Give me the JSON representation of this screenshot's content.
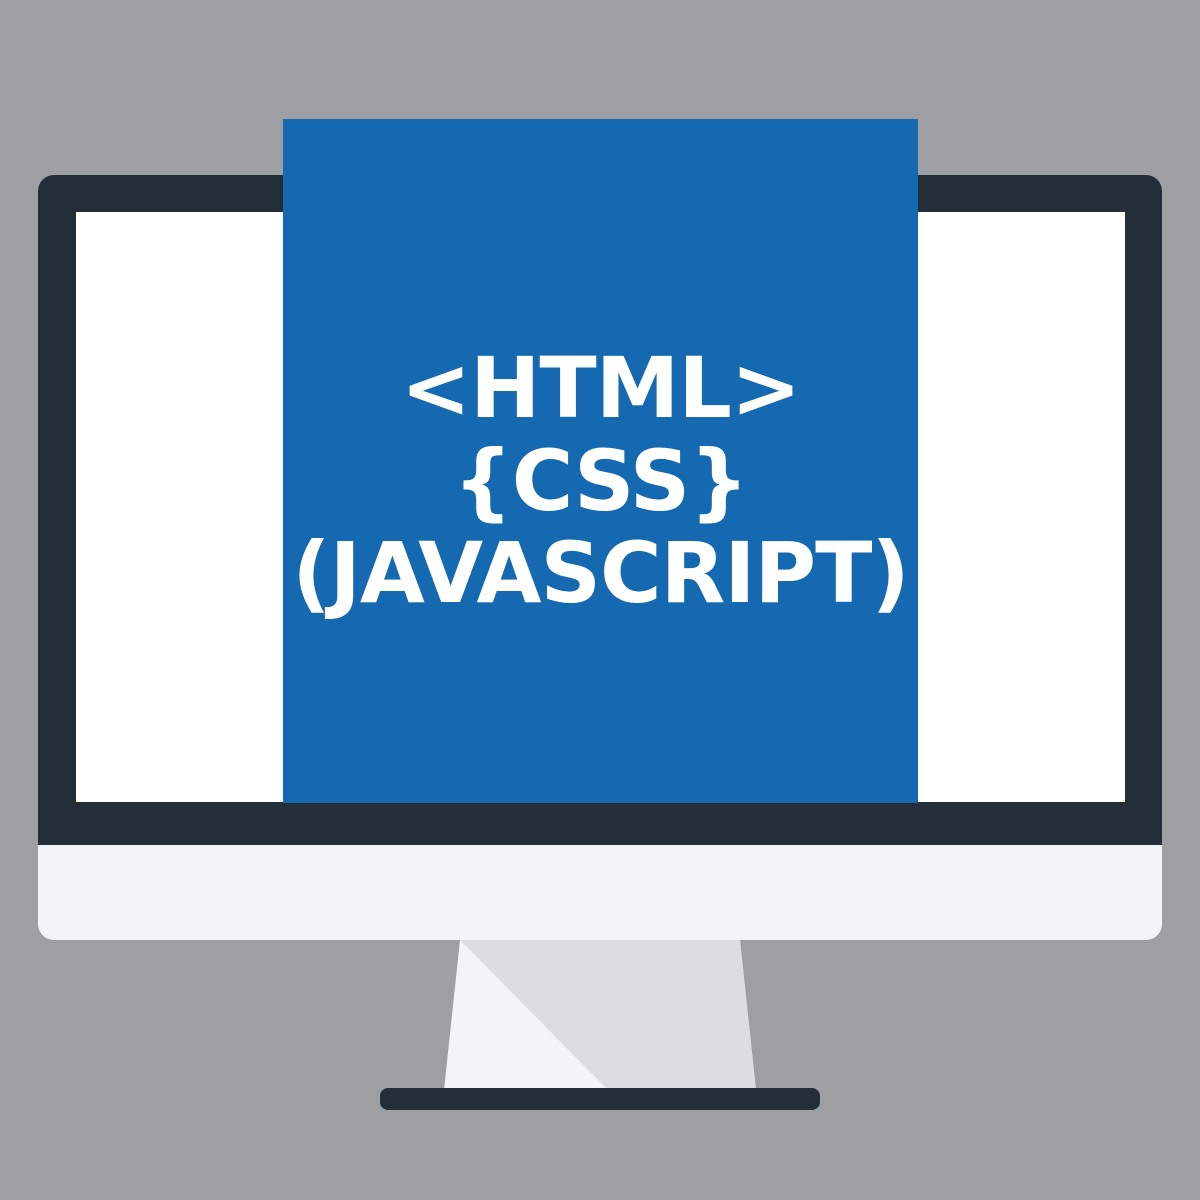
{
  "illustration": {
    "subject": "desktop-monitor",
    "colors": {
      "background": "#9e9fa3",
      "bezel": "#232e39",
      "screen": "#ffffff",
      "chin": "#f3f4f6",
      "stand_light": "#f3f4f6",
      "stand_shadow": "#dcdde0",
      "card": "#1569b0",
      "text": "#ffffff"
    },
    "card": {
      "lines": [
        "<HTML>",
        "{CSS}",
        "(JAVASCRIPT)"
      ]
    }
  }
}
